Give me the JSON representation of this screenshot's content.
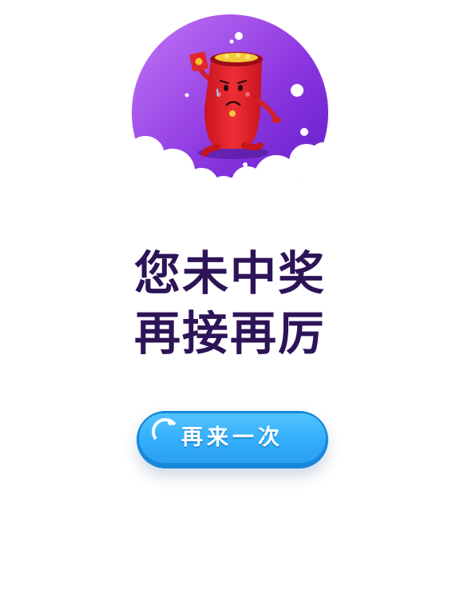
{
  "result": {
    "line1": "您未中奖",
    "line2": "再接再厉"
  },
  "retry": {
    "label": "再来一次"
  },
  "illustration": {
    "subject": "red-envelope-mascot-icon"
  },
  "colors": {
    "title": "#2d1457",
    "circle_light": "#b666f2",
    "circle_dark": "#6a1fcc",
    "envelope": "#e0262e",
    "button": "#33aef9",
    "button_edge": "#1787db"
  }
}
